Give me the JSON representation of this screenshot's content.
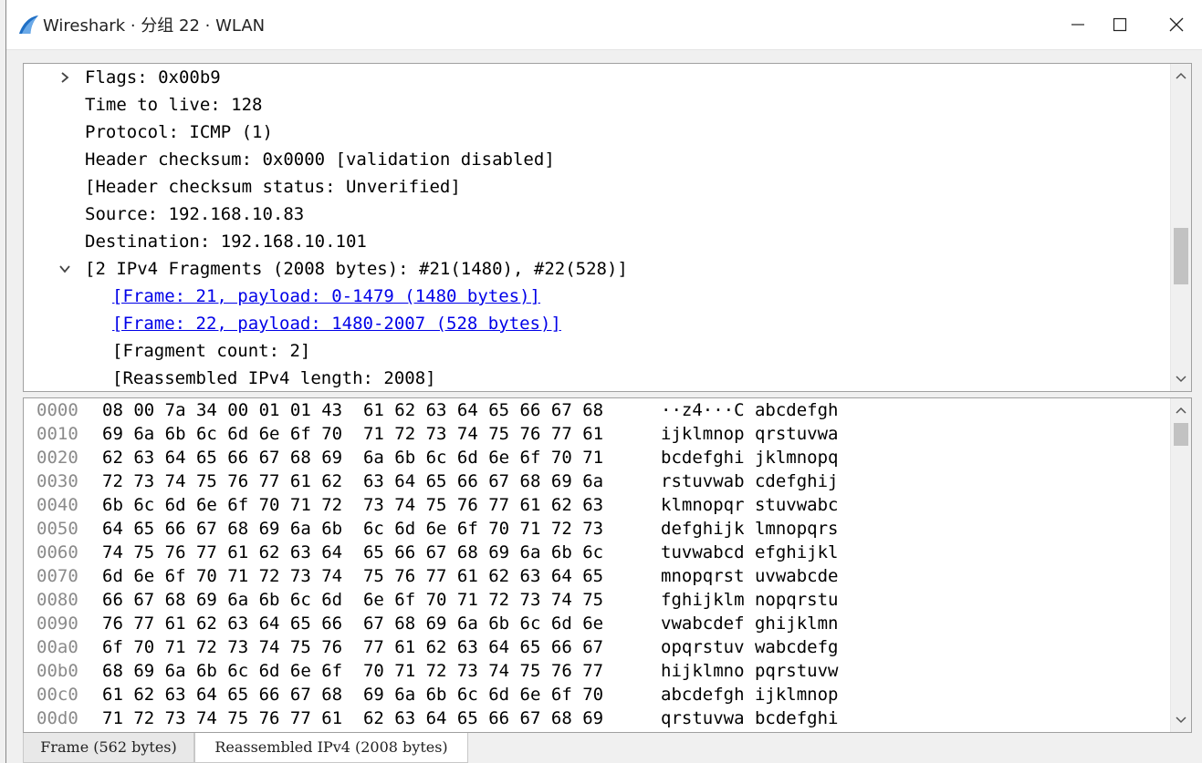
{
  "window": {
    "title": "Wireshark · 分组 22 · WLAN"
  },
  "detail_tree": {
    "lines": [
      {
        "text": "Flags: 0x00b9",
        "indent": 1,
        "expander": "collapsed",
        "link": false
      },
      {
        "text": "Time to live: 128",
        "indent": 1,
        "expander": "none",
        "link": false
      },
      {
        "text": "Protocol: ICMP (1)",
        "indent": 1,
        "expander": "none",
        "link": false
      },
      {
        "text": "Header checksum: 0x0000 [validation disabled]",
        "indent": 1,
        "expander": "none",
        "link": false
      },
      {
        "text": "[Header checksum status: Unverified]",
        "indent": 1,
        "expander": "none",
        "link": false
      },
      {
        "text": "Source: 192.168.10.83",
        "indent": 1,
        "expander": "none",
        "link": false
      },
      {
        "text": "Destination: 192.168.10.101",
        "indent": 1,
        "expander": "none",
        "link": false
      },
      {
        "text": "[2 IPv4 Fragments (2008 bytes): #21(1480), #22(528)]",
        "indent": 1,
        "expander": "expanded",
        "link": false
      },
      {
        "text": "[Frame: 21, payload: 0-1479 (1480 bytes)]",
        "indent": 2,
        "expander": "none",
        "link": true
      },
      {
        "text": "[Frame: 22, payload: 1480-2007 (528 bytes)]",
        "indent": 2,
        "expander": "none",
        "link": true
      },
      {
        "text": "[Fragment count: 2]",
        "indent": 2,
        "expander": "none",
        "link": false
      },
      {
        "text": "[Reassembled IPv4 length: 2008]",
        "indent": 2,
        "expander": "none",
        "link": false
      }
    ]
  },
  "hex_dump": {
    "rows": [
      {
        "offset": "0000",
        "bytes": "08 00 7a 34 00 01 01 43  61 62 63 64 65 66 67 68",
        "ascii": "··z4···C abcdefgh"
      },
      {
        "offset": "0010",
        "bytes": "69 6a 6b 6c 6d 6e 6f 70  71 72 73 74 75 76 77 61",
        "ascii": "ijklmnop qrstuvwa"
      },
      {
        "offset": "0020",
        "bytes": "62 63 64 65 66 67 68 69  6a 6b 6c 6d 6e 6f 70 71",
        "ascii": "bcdefghi jklmnopq"
      },
      {
        "offset": "0030",
        "bytes": "72 73 74 75 76 77 61 62  63 64 65 66 67 68 69 6a",
        "ascii": "rstuvwab cdefghij"
      },
      {
        "offset": "0040",
        "bytes": "6b 6c 6d 6e 6f 70 71 72  73 74 75 76 77 61 62 63",
        "ascii": "klmnopqr stuvwabc"
      },
      {
        "offset": "0050",
        "bytes": "64 65 66 67 68 69 6a 6b  6c 6d 6e 6f 70 71 72 73",
        "ascii": "defghijk lmnopqrs"
      },
      {
        "offset": "0060",
        "bytes": "74 75 76 77 61 62 63 64  65 66 67 68 69 6a 6b 6c",
        "ascii": "tuvwabcd efghijkl"
      },
      {
        "offset": "0070",
        "bytes": "6d 6e 6f 70 71 72 73 74  75 76 77 61 62 63 64 65",
        "ascii": "mnopqrst uvwabcde"
      },
      {
        "offset": "0080",
        "bytes": "66 67 68 69 6a 6b 6c 6d  6e 6f 70 71 72 73 74 75",
        "ascii": "fghijklm nopqrstu"
      },
      {
        "offset": "0090",
        "bytes": "76 77 61 62 63 64 65 66  67 68 69 6a 6b 6c 6d 6e",
        "ascii": "vwabcdef ghijklmn"
      },
      {
        "offset": "00a0",
        "bytes": "6f 70 71 72 73 74 75 76  77 61 62 63 64 65 66 67",
        "ascii": "opqrstuv wabcdefg"
      },
      {
        "offset": "00b0",
        "bytes": "68 69 6a 6b 6c 6d 6e 6f  70 71 72 73 74 75 76 77",
        "ascii": "hijklmno pqrstuvw"
      },
      {
        "offset": "00c0",
        "bytes": "61 62 63 64 65 66 67 68  69 6a 6b 6c 6d 6e 6f 70",
        "ascii": "abcdefgh ijklmnop"
      },
      {
        "offset": "00d0",
        "bytes": "71 72 73 74 75 76 77 61  62 63 64 65 66 67 68 69",
        "ascii": "qrstuvwa bcdefghi"
      }
    ]
  },
  "tabs": [
    {
      "label": "Frame (562 bytes)",
      "active": false
    },
    {
      "label": "Reassembled IPv4 (2008 bytes)",
      "active": true
    }
  ],
  "colors": {
    "link": "#0000e8",
    "offset": "#8a8a8a",
    "shark_fin": "#1f6fc5"
  },
  "icons": {
    "app": "wireshark-fin-icon",
    "minimize": "minimize-icon",
    "maximize": "maximize-icon",
    "close": "close-icon"
  }
}
